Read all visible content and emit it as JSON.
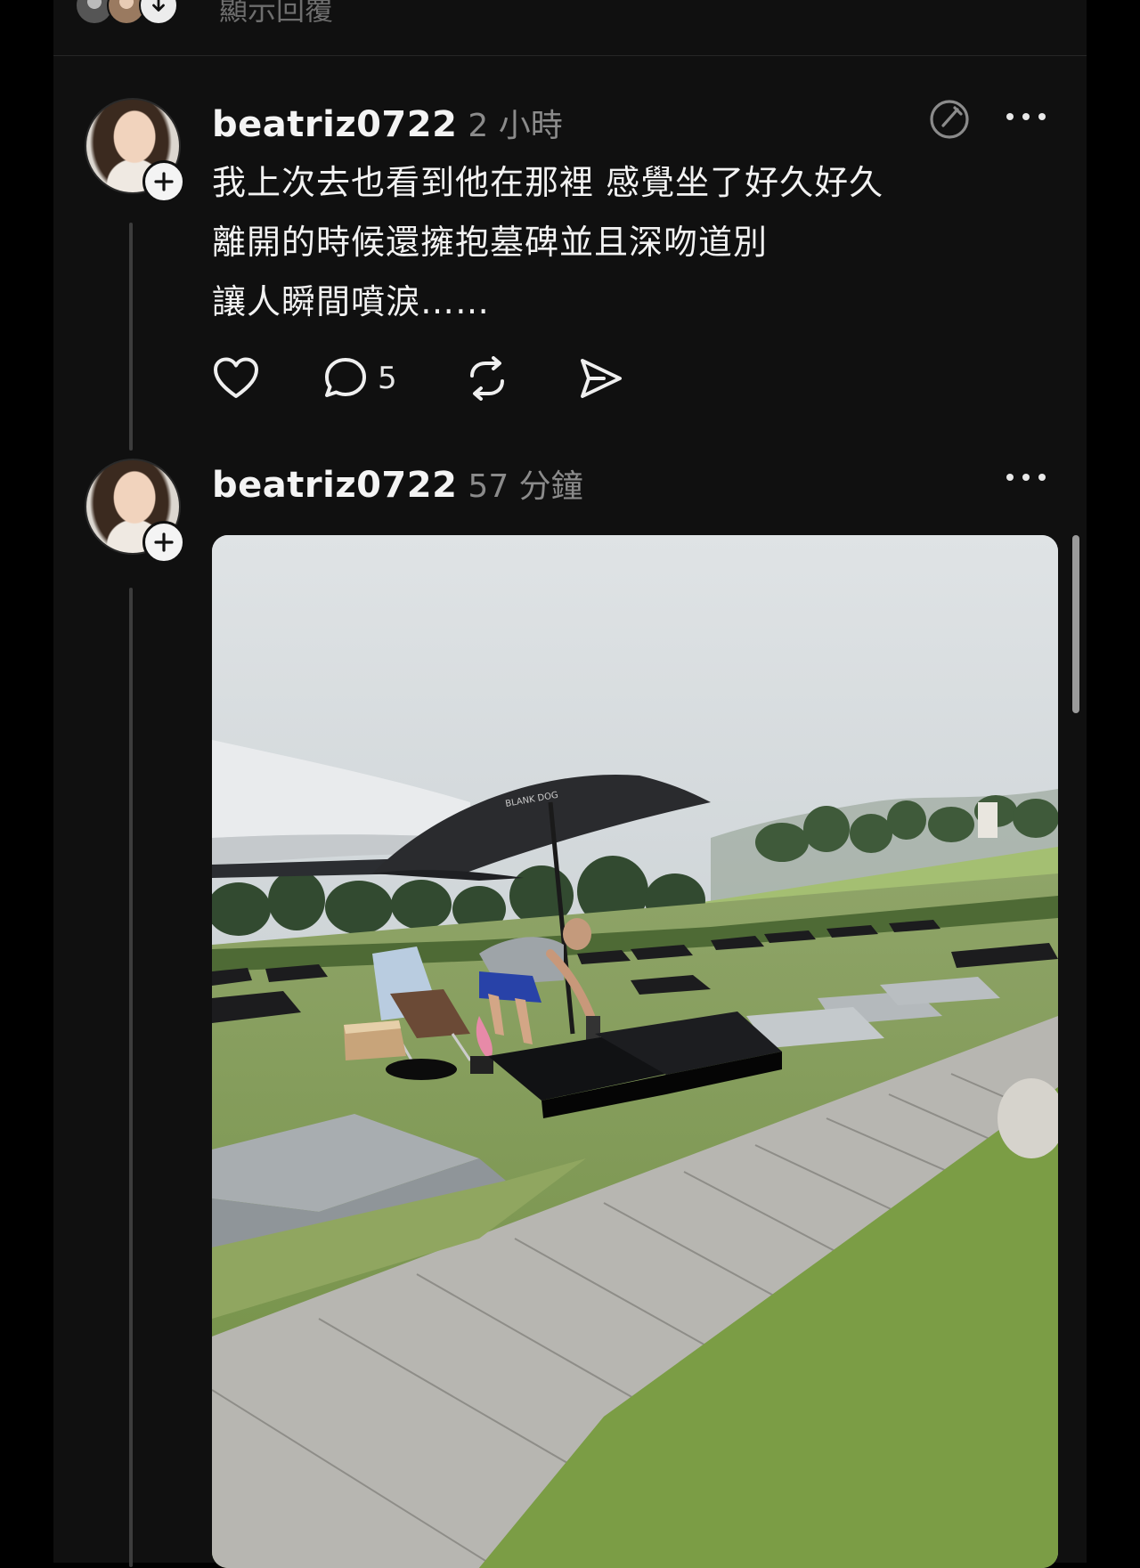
{
  "thread": {
    "show_replies_label": "顯示回覆"
  },
  "posts": [
    {
      "username": "beatriz0722",
      "timestamp": "2 小時",
      "lines": [
        "我上次去也看到他在那裡 感覺坐了好久好久",
        "離開的時候還擁抱墓碑並且深吻道別",
        "讓人瞬間噴淚……"
      ],
      "reply_count": "5",
      "icons": [
        "edit-icon",
        "more-icon",
        "heart-icon",
        "comment-icon",
        "repost-icon",
        "share-icon"
      ]
    },
    {
      "username": "beatriz0722",
      "timestamp": "57 分鐘",
      "icons": [
        "more-icon"
      ],
      "image": {
        "umbrella_text": "BLANK DOG",
        "palette": {
          "sky": "#d9dddf",
          "grass": "#7d9a52",
          "slab": "#8f9599",
          "granite": "#1c1c1e",
          "umbrella": "#2a2b2e"
        }
      }
    }
  ],
  "colors": {
    "background": "#101010",
    "text": "#f2f2f2",
    "muted": "#8b8b8b",
    "thread_line": "#3c3c3c"
  }
}
